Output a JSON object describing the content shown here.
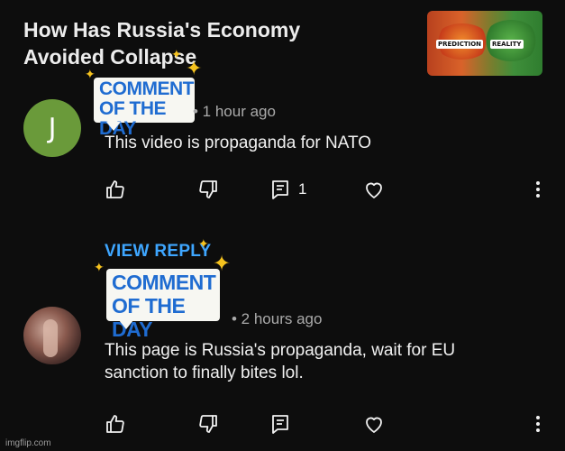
{
  "video": {
    "title_line1": "How Has Russia's Economy",
    "title_line2": "Avoided Collapse",
    "thumbnail": {
      "label_left": "PREDICTION",
      "label_right": "REALITY"
    }
  },
  "badge": {
    "line1": "COMMENT",
    "line2": "OF THE DAY"
  },
  "comments": [
    {
      "avatar_letter": "J",
      "avatar_color": "#6a9a3a",
      "timestamp": "• 1 hour ago",
      "text": "This video is propaganda for NATO",
      "reply_count": "1",
      "view_reply_label": "VIEW REPLY"
    },
    {
      "timestamp": "• 2 hours ago",
      "text_line1": "This page is Russia's propaganda, wait for EU",
      "text_line2": "sanction to finally bites lol."
    }
  ],
  "icons": [
    "thumbs-up-icon",
    "thumbs-down-icon",
    "reply-icon",
    "heart-icon",
    "more-vert-icon"
  ],
  "colors": {
    "background": "#0d0d0d",
    "link": "#3ea6ff",
    "badge_text": "#1f6cd1",
    "sparkle": "#f5c21e"
  },
  "watermark": "imgflip.com"
}
